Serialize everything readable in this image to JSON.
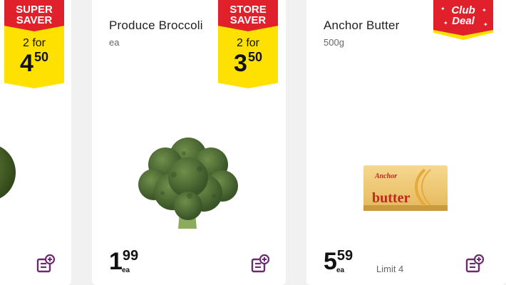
{
  "accent_red": "#e0212b",
  "accent_yellow": "#ffe100",
  "products": [
    {
      "badge": {
        "line1": "SUPER",
        "line2": "SAVER",
        "qty": "2 for",
        "price_major": "4",
        "price_minor": "50"
      },
      "add_icon": "add-to-list-icon"
    },
    {
      "name": "Produce Broccoli",
      "unit": "ea",
      "badge": {
        "line1": "STORE",
        "line2": "SAVER",
        "qty": "2 for",
        "price_major": "3",
        "price_minor": "50"
      },
      "price": {
        "major": "1",
        "minor": "99",
        "unit": "ea"
      },
      "add_icon": "add-to-list-icon"
    },
    {
      "name": "Anchor Butter",
      "unit": "500g",
      "badge": {
        "line1": "Club",
        "line2": "Deal"
      },
      "image_text": {
        "brand": "Anchor",
        "word": "butter"
      },
      "price": {
        "major": "5",
        "minor": "59",
        "unit": "ea"
      },
      "limit": "Limit 4",
      "add_icon": "add-to-list-icon"
    }
  ]
}
